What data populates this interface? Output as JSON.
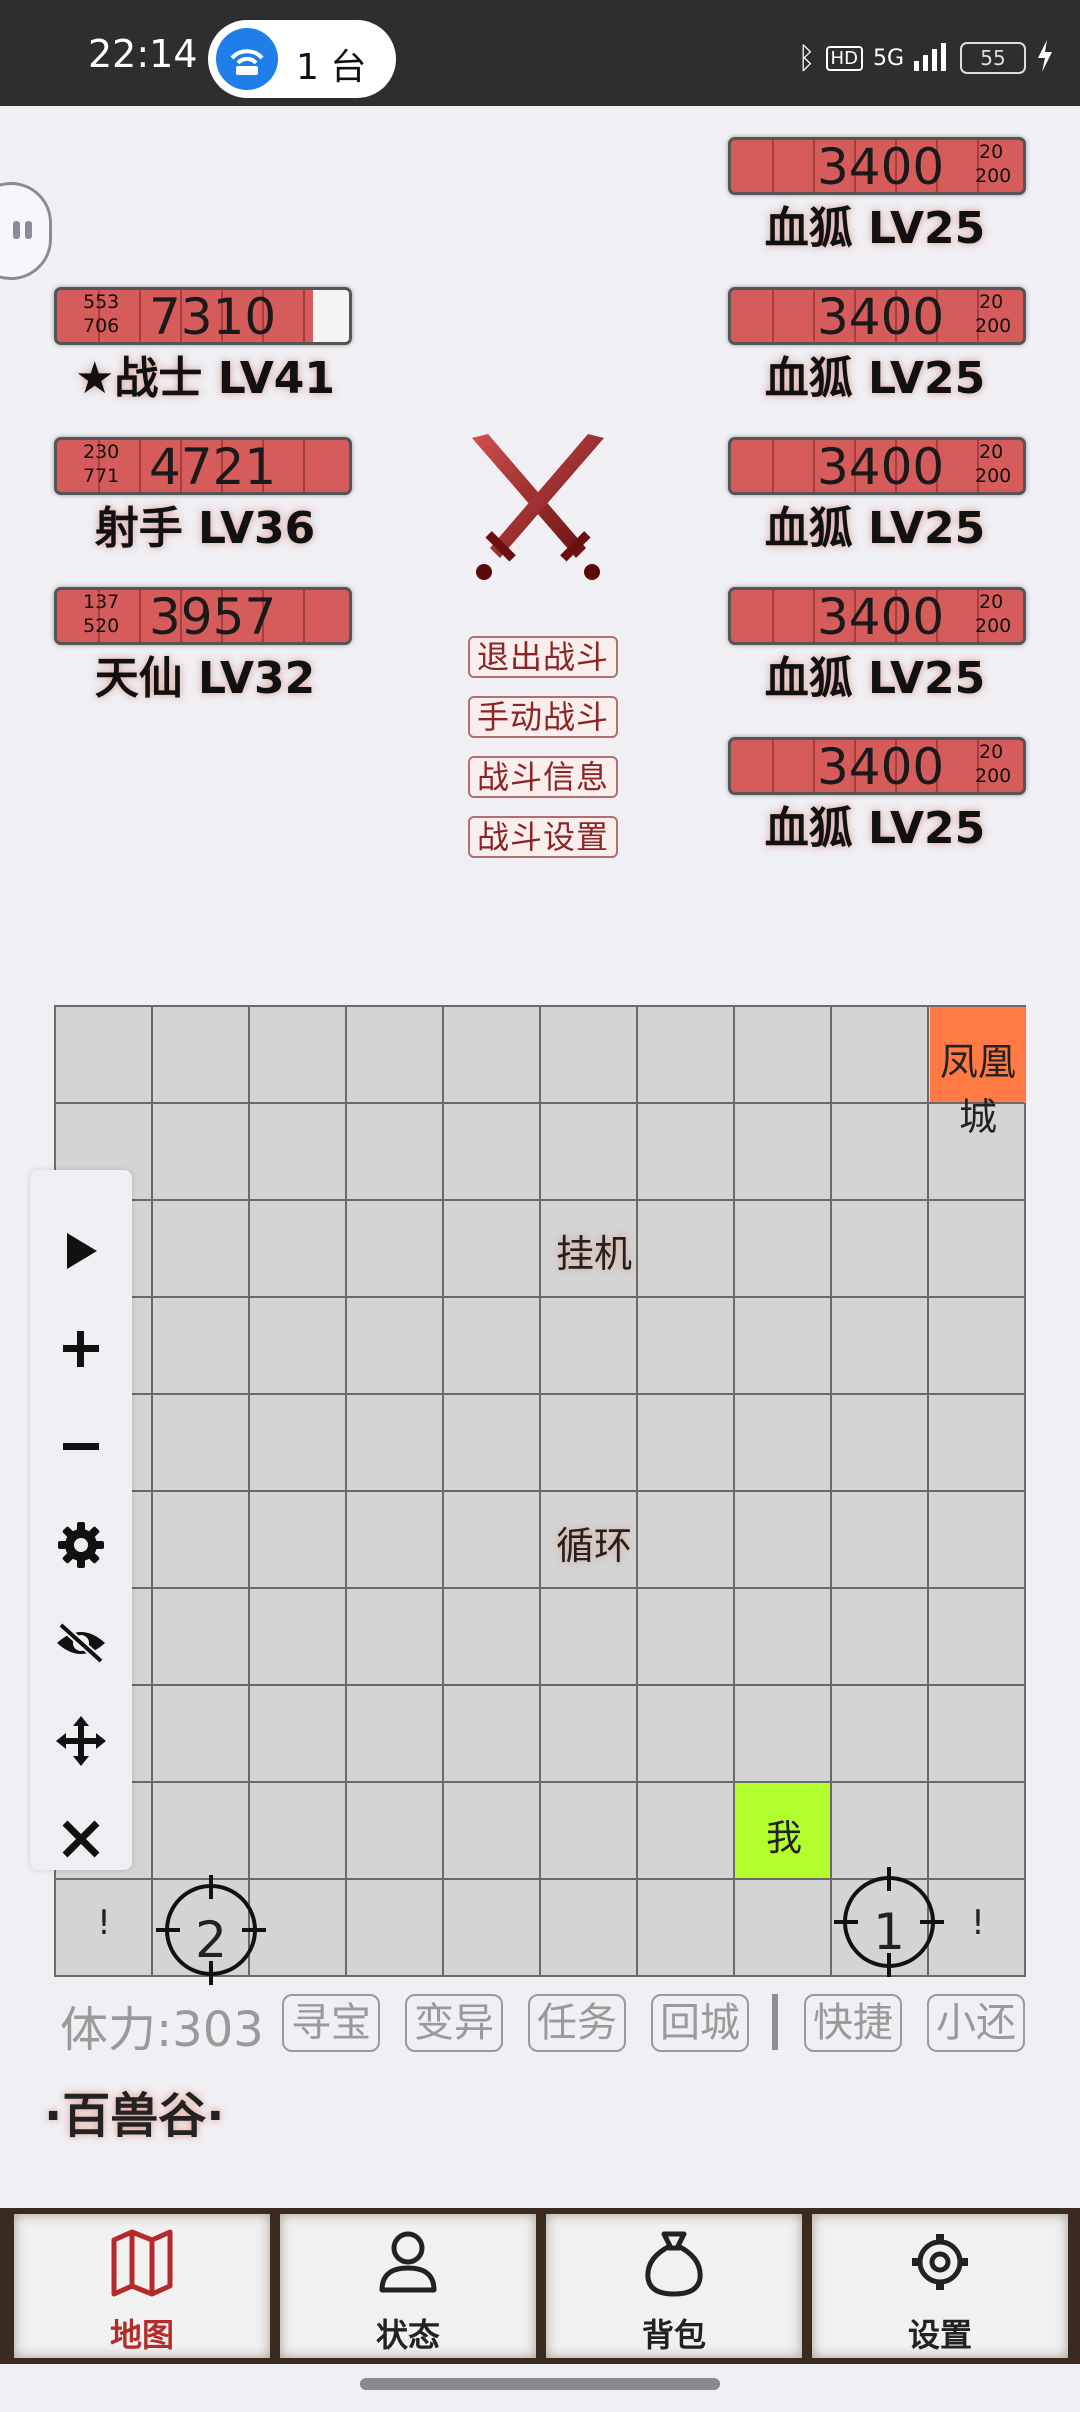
{
  "status_bar": {
    "time": "22:14",
    "hotspot_count": "1 台",
    "hd": "HD",
    "signal": "5G",
    "battery": "55"
  },
  "party": [
    {
      "hp": "7310",
      "atk": "553",
      "def": "706",
      "name": "★战士 LV41",
      "hp_fraction": 0.87
    },
    {
      "hp": "4721",
      "atk": "230",
      "def": "771",
      "name": "射手 LV36",
      "hp_fraction": 1.0
    },
    {
      "hp": "3957",
      "atk": "137",
      "def": "520",
      "name": "天仙 LV32",
      "hp_fraction": 1.0
    }
  ],
  "enemies": [
    {
      "hp": "3400",
      "atk": "20",
      "def": "200",
      "name": "血狐 LV25"
    },
    {
      "hp": "3400",
      "atk": "20",
      "def": "200",
      "name": "血狐 LV25"
    },
    {
      "hp": "3400",
      "atk": "20",
      "def": "200",
      "name": "血狐 LV25"
    },
    {
      "hp": "3400",
      "atk": "20",
      "def": "200",
      "name": "血狐 LV25"
    },
    {
      "hp": "3400",
      "atk": "20",
      "def": "200",
      "name": "血狐 LV25"
    }
  ],
  "battle_buttons": [
    "退出战斗",
    "手动战斗",
    "战斗信息",
    "战斗设置"
  ],
  "map": {
    "city_label": "凤凰城",
    "idle_label": "挂机",
    "loop_label": "循环",
    "me_label": "我",
    "marker_left": "!",
    "marker_right": "!",
    "target_1": "1",
    "target_2": "2"
  },
  "tools": [
    "play-icon",
    "plus-icon",
    "minus-icon",
    "gear-icon",
    "eye-off-icon",
    "move-icon",
    "close-icon"
  ],
  "actions": {
    "stamina": "体力:303",
    "buttons": [
      "寻宝",
      "变异",
      "任务",
      "回城"
    ],
    "shortcut": "快捷",
    "restore": "小还"
  },
  "location": "·百兽谷·",
  "nav": [
    {
      "label": "地图",
      "icon": "map-icon",
      "active": true
    },
    {
      "label": "状态",
      "icon": "person-icon",
      "active": false
    },
    {
      "label": "背包",
      "icon": "bag-icon",
      "active": false
    },
    {
      "label": "设置",
      "icon": "gear-icon",
      "active": false
    }
  ],
  "colors": {
    "hp_bar": "#d65c5c",
    "city_cell": "#ff7a45",
    "me_cell": "#b3ff2e",
    "nav_active": "#b52a2a"
  }
}
